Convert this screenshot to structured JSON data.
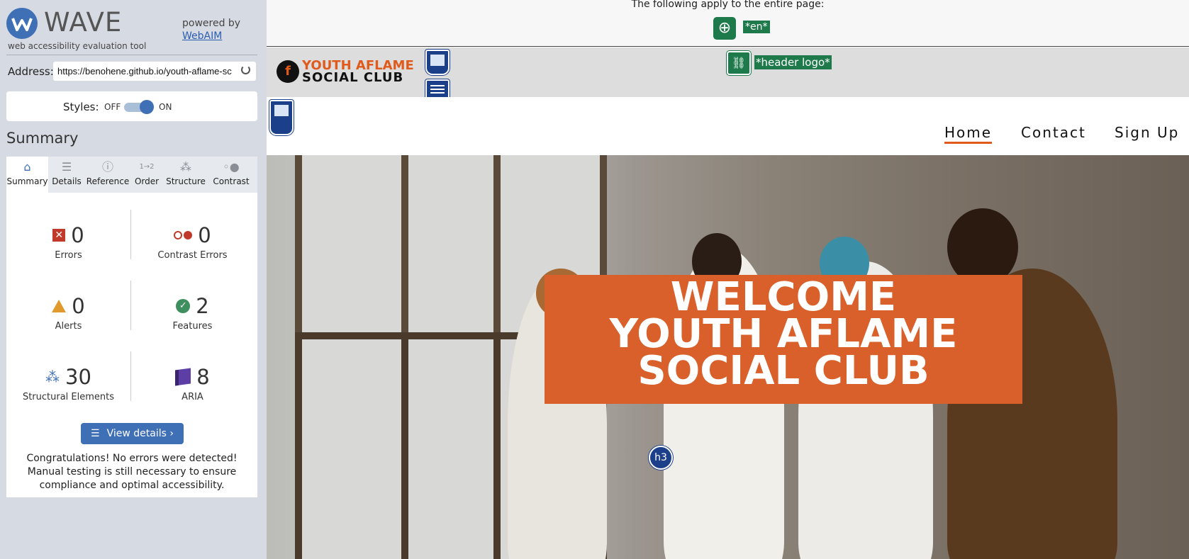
{
  "wave": {
    "logo_text": "WAVE",
    "tagline": "web accessibility evaluation tool",
    "powered_by": "powered by",
    "webaim_link": "WebAIM",
    "address_label": "Address:",
    "address_value": "https://benohene.github.io/youth-aflame-sc",
    "styles_label": "Styles:",
    "styles_off": "OFF",
    "styles_on": "ON",
    "summary_heading": "Summary",
    "tabs": [
      {
        "label": "Summary",
        "icon": "home-icon",
        "active": true
      },
      {
        "label": "Details",
        "icon": "list-icon",
        "active": false
      },
      {
        "label": "Reference",
        "icon": "info-icon",
        "active": false
      },
      {
        "label": "Order",
        "icon": "order-icon",
        "active": false
      },
      {
        "label": "Structure",
        "icon": "structure-icon",
        "active": false
      },
      {
        "label": "Contrast",
        "icon": "contrast-icon",
        "active": false
      }
    ],
    "stats": {
      "errors": {
        "value": "0",
        "label": "Errors"
      },
      "contrast_errors": {
        "value": "0",
        "label": "Contrast Errors"
      },
      "alerts": {
        "value": "0",
        "label": "Alerts"
      },
      "features": {
        "value": "2",
        "label": "Features"
      },
      "structural": {
        "value": "30",
        "label": "Structural Elements"
      },
      "aria": {
        "value": "8",
        "label": "ARIA"
      }
    },
    "view_details": "View details ›",
    "congrats": "Congratulations! No errors were detected! Manual testing is still necessary to ensure compliance and optimal accessibility."
  },
  "page": {
    "top_note": "The following apply to the entire page:",
    "lang_tag": "*en*",
    "logo_line1": "YOUTH AFLAME",
    "logo_line2": "SOCIAL CLUB",
    "logo_letter": "f",
    "alt_tag": "*header logo*",
    "nav": [
      "Home",
      "Contact",
      "Sign Up"
    ],
    "h3_badge": "h3",
    "welcome_lines": [
      "WELCOME",
      "YOUTH AFLAME",
      "SOCIAL CLUB"
    ]
  },
  "colors": {
    "wave_blue": "#3f6fb5",
    "feature_green": "#1e7a4b",
    "brand_orange": "#e05a1c"
  }
}
